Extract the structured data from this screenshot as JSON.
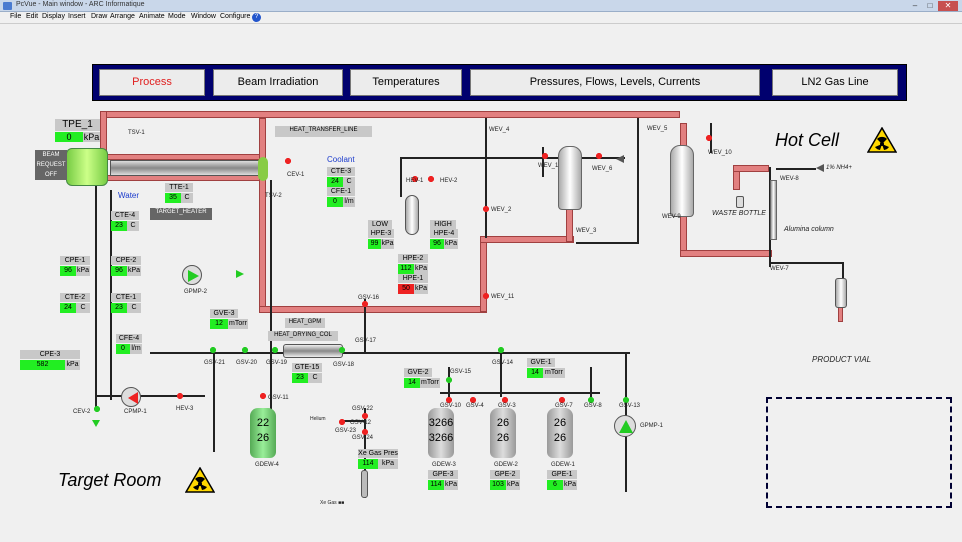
{
  "window": {
    "title": "PcVue - Main window - ARC Informatique",
    "minimize": "–",
    "maximize": "□",
    "close": "✕"
  },
  "menu": [
    "File",
    "Edit",
    "Display",
    "Insert",
    "Draw",
    "Arrange",
    "Animate",
    "Mode",
    "Window",
    "Configure"
  ],
  "nav": [
    {
      "label": "Process",
      "active": true
    },
    {
      "label": "Beam Irradiation"
    },
    {
      "label": "Temperatures"
    },
    {
      "label": "Pressures, Flows, Levels, Currents"
    },
    {
      "label": "LN2 Gas Line"
    }
  ],
  "areas": {
    "hot_cell": "Hot Cell",
    "target_room": "Target Room"
  },
  "tpe": {
    "name": "TPE_1",
    "value": "0",
    "unit": "kPa"
  },
  "beam": {
    "text": "BEAM REQUEST OFF"
  },
  "labels": {
    "water": "Water",
    "coolant": "Coolant",
    "heat_transfer_line": "HEAT_TRANSFER_LINE",
    "target_heater": "TARGET_HEATER",
    "heat_gpm": "HEAT_GPM",
    "heat_drying_col": "HEAT_DRYING_COL",
    "waste_bottle": "WASTE BOTTLE",
    "alumina_column": "Alumina column",
    "product_vial": "PRODUCT VIAL",
    "nh4": "1% NH4+",
    "xe_gas_pres": "Xe Gas Pres",
    "helium": "Helium",
    "xe_gas": "Xe Gas ■■",
    "low": "LOW",
    "high": "HIGH"
  },
  "readouts": [
    {
      "name": "TTE-1",
      "value": "35",
      "unit": "C"
    },
    {
      "name": "CTE-4",
      "value": "23",
      "unit": "C"
    },
    {
      "name": "CTE-3",
      "value": "24",
      "unit": "C"
    },
    {
      "name": "CFE-1",
      "value": "0",
      "unit": "l/m"
    },
    {
      "name": "CPE-1",
      "value": "96",
      "unit": "kPa"
    },
    {
      "name": "CPE-2",
      "value": "96",
      "unit": "kPa"
    },
    {
      "name": "CTE-2",
      "value": "24",
      "unit": "C"
    },
    {
      "name": "CTE-1",
      "value": "23",
      "unit": "C"
    },
    {
      "name": "CFE-4",
      "value": "0",
      "unit": "l/m"
    },
    {
      "name": "CPE-3",
      "value": "582",
      "unit": "kPa"
    },
    {
      "name": "HPE-3",
      "value": "99",
      "unit": "kPa"
    },
    {
      "name": "HPE-4",
      "value": "96",
      "unit": "kPa"
    },
    {
      "name": "HPE-2",
      "value": "112",
      "unit": "kPa"
    },
    {
      "name": "HPE-1",
      "value": "50",
      "unit": "kPa",
      "alarm": true
    },
    {
      "name": "GVE-3",
      "value": "12",
      "unit": "mTorr"
    },
    {
      "name": "GTE-15",
      "value": "23",
      "unit": "C"
    },
    {
      "name": "GVE-2",
      "value": "14",
      "unit": "mTorr"
    },
    {
      "name": "GVE-1",
      "value": "14",
      "unit": "mTorr"
    },
    {
      "name": "Xe Gas Pres",
      "value": "114",
      "unit": "kPa"
    },
    {
      "name": "GPE-3",
      "value": "114",
      "unit": "kPa"
    },
    {
      "name": "GPE-2",
      "value": "103",
      "unit": "kPa"
    },
    {
      "name": "GPE-1",
      "value": "6",
      "unit": "kPa"
    }
  ],
  "tanks": [
    {
      "name": "GDEW-4",
      "top": "22",
      "bottom": "26"
    },
    {
      "name": "GDEW-3",
      "top": "3266",
      "bottom": "3266"
    },
    {
      "name": "GDEW-2",
      "top": "26",
      "bottom": "26"
    },
    {
      "name": "GDEW-1",
      "top": "26",
      "bottom": "26"
    }
  ],
  "valves": [
    "TSV-1",
    "TSV-2",
    "CEV-1",
    "HEV-1",
    "HEV-2",
    "WEV_4",
    "WEV_1",
    "WEV_6",
    "WEV_5",
    "WEV_10",
    "WEV-8",
    "WEV-7",
    "WEV-9",
    "WEV_2",
    "WEV_3",
    "WEV_11",
    "GSV-16",
    "GSV-17",
    "GSV-21",
    "GSV-20",
    "GSV-19",
    "GSV-18",
    "GSV-14",
    "GSV-15",
    "GSV-10",
    "GSV-4",
    "GSV-3",
    "GSV-7",
    "GSV-8",
    "GSV-13",
    "GSV-11",
    "GSV-12",
    "GSV-22",
    "GSV-23",
    "GSV-24",
    "CEV-2",
    "HEV-3",
    "CPMP-1",
    "GPMP-2",
    "GPMP-1"
  ],
  "colors": {
    "pipe": "#e28080",
    "green": "#22ee22",
    "alarm": "#ee2222",
    "nav_bg": "#00006e"
  }
}
